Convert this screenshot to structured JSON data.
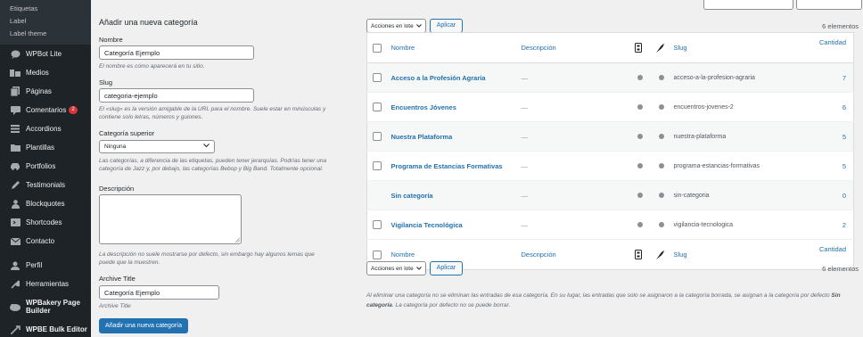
{
  "sidebar": {
    "subitems": [
      "Etiquetas",
      "Label",
      "Label theme"
    ],
    "items": [
      {
        "label": "WPBot Lite",
        "icon": "chat-bubble-icon"
      },
      {
        "label": "Medios",
        "icon": "media-icon"
      },
      {
        "label": "Páginas",
        "icon": "pages-icon"
      },
      {
        "label": "Comentarios",
        "icon": "comments-icon",
        "badge": "2"
      },
      {
        "label": "Accordions",
        "icon": "accordion-icon"
      },
      {
        "label": "Plantillas",
        "icon": "folder-icon"
      },
      {
        "label": "Portfolios",
        "icon": "car-icon"
      },
      {
        "label": "Testimonials",
        "icon": "quote-pen-icon"
      },
      {
        "label": "Blockquotes",
        "icon": "people-icon"
      },
      {
        "label": "Shortcodes",
        "icon": "shortcode-icon"
      },
      {
        "label": "Contacto",
        "icon": "mail-icon"
      },
      {
        "label": "Perfil",
        "icon": "user-icon"
      },
      {
        "label": "Herramientas",
        "icon": "wrench-icon"
      },
      {
        "label": "WPBakery Page Builder",
        "icon": "bakery-icon"
      },
      {
        "label": "WPBE Bulk Editor",
        "icon": "edit-arrow-icon"
      }
    ]
  },
  "form": {
    "title": "Añadir una nueva categoría",
    "name_label": "Nombre",
    "name_value": "Categoría Ejemplo",
    "name_help": "El nombre es cómo aparecerá en tu sitio.",
    "slug_label": "Slug",
    "slug_value": "categoria-ejemplo",
    "slug_help": "El «slug» es la versión amigable de la URL para el nombre. Suele estar en minúsculas y contiene solo letras, números y guiones.",
    "parent_label": "Categoría superior",
    "parent_value": "Ninguna",
    "parent_help": "Las categorías, a diferencia de las etiquetas, pueden tener jerarquías. Podrías tener una categoría de Jazz y, por debajo, las categorías Bebop y Big Band. Totalmente opcional.",
    "desc_label": "Descripción",
    "desc_help": "La descripción no suele mostrarse por defecto, sin embargo hay algunos temas que puede que la muestren.",
    "archive_label": "Archive Title",
    "archive_value": "Categoría Ejemplo",
    "archive_help": "Archive Title",
    "submit": "Añadir una nueva categoría"
  },
  "table": {
    "bulk_label": "Acciones en lote",
    "apply_label": "Aplicar",
    "count": "6 elementos",
    "columns": {
      "name": "Nombre",
      "description": "Descripción",
      "slug": "Slug",
      "count": "Cantidad"
    },
    "rows": [
      {
        "name": "Acceso a la Profesión Agraria",
        "description": "—",
        "slug": "acceso-a-la-profesion-agraria",
        "count": "7",
        "checkbox": true
      },
      {
        "name": "Encuentros Jóvenes",
        "description": "—",
        "slug": "encuentros-jovenes-2",
        "count": "6",
        "checkbox": true
      },
      {
        "name": "Nuestra Plataforma",
        "description": "—",
        "slug": "nuestra-plataforma",
        "count": "5",
        "checkbox": true
      },
      {
        "name": "Programa de Estancias Formativas",
        "description": "—",
        "slug": "programa-estancias-formativas",
        "count": "5",
        "checkbox": true
      },
      {
        "name": "Sin categoría",
        "description": "—",
        "slug": "sin-categoria",
        "count": "0",
        "checkbox": false
      },
      {
        "name": "Vigilancia Tecnológica",
        "description": "—",
        "slug": "vigilancia-tecnologica",
        "count": "2",
        "checkbox": true
      }
    ],
    "note_part1": "Al eliminar una categoría no se eliminan las entradas de esa categoría. En su lugar, las entradas que solo se asignaron a la categoría borrada, se asignan a la categoría por defecto ",
    "note_bold": "Sin categoría",
    "note_part2": ". La categoría por defecto no se puede borrar."
  },
  "colors": {
    "accent": "#2271b1",
    "sidebar": "#1d2327",
    "badge": "#d63638"
  }
}
